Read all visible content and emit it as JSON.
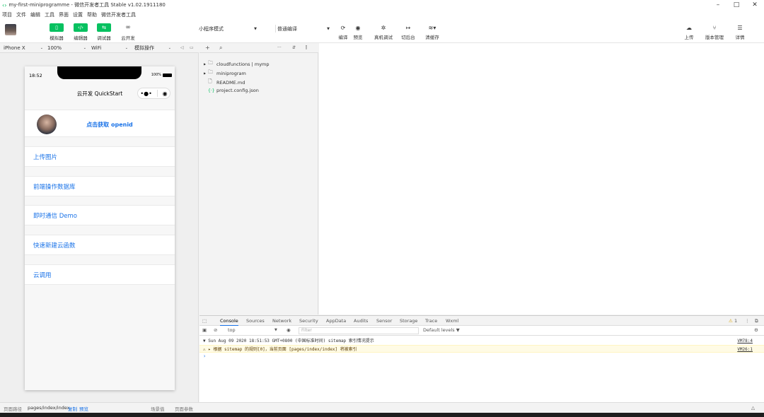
{
  "window": {
    "title": "my-first-miniprogramme - 微信开发者工具 Stable v1.02.1911180",
    "controls": [
      "–",
      "□",
      "✕"
    ]
  },
  "menu": [
    "项目",
    "文件",
    "编辑",
    "工具",
    "界面",
    "设置",
    "帮助",
    "微信开发者工具"
  ],
  "toolbar": {
    "simulator": "模拟器",
    "editor": "编辑器",
    "debugger": "调试器",
    "cloud": "云开发",
    "mode_select": "小程序模式",
    "compile_select": "普通编译",
    "compile": "编译",
    "preview": "预览",
    "real_debug": "真机调试",
    "background": "切后台",
    "clear_cache": "清缓存",
    "upload": "上传",
    "version": "版本管理",
    "details": "详情"
  },
  "sim_header": {
    "device": "iPhone X",
    "zoom": "100%",
    "network": "WiFi",
    "operation": "模拟操作"
  },
  "phone": {
    "time": "18:52",
    "battery": "100%",
    "nav_title": "云开发 QuickStart",
    "openid_button": "点击获取 openid",
    "menu_items": [
      "上传图片",
      "前端操作数据库",
      "即时通信 Demo",
      "快速新建云函数",
      "云调用"
    ]
  },
  "filetree": {
    "items": [
      {
        "name": "cloudfunctions | mymp",
        "type": "folder"
      },
      {
        "name": "miniprogram",
        "type": "folder"
      },
      {
        "name": "README.md",
        "type": "file"
      },
      {
        "name": "project.config.json",
        "type": "json"
      }
    ]
  },
  "debugger": {
    "tabs": [
      "Console",
      "Sources",
      "Network",
      "Security",
      "AppData",
      "Audits",
      "Sensor",
      "Storage",
      "Trace",
      "Wxml"
    ],
    "context": "top",
    "filter_placeholder": "Filter",
    "levels": "Default levels ▼",
    "warning_count": "1",
    "logs": [
      {
        "text": "▼ Sun Aug 09 2020 18:51:53 GMT+0800 (中国标准时间) sitemap 索引情况提示",
        "source": "VM78:4"
      },
      {
        "text": "⚠ ▸ 根据 sitemap 的规则[0]，当前页面 [pages/index/index] 将被索引",
        "source": "VM26:1"
      }
    ]
  },
  "statusbar": {
    "path_label": "页面路径",
    "path": "pages/index/index",
    "copy": "复制",
    "preview": "预览",
    "scene": "场景值",
    "params": "页面参数"
  }
}
